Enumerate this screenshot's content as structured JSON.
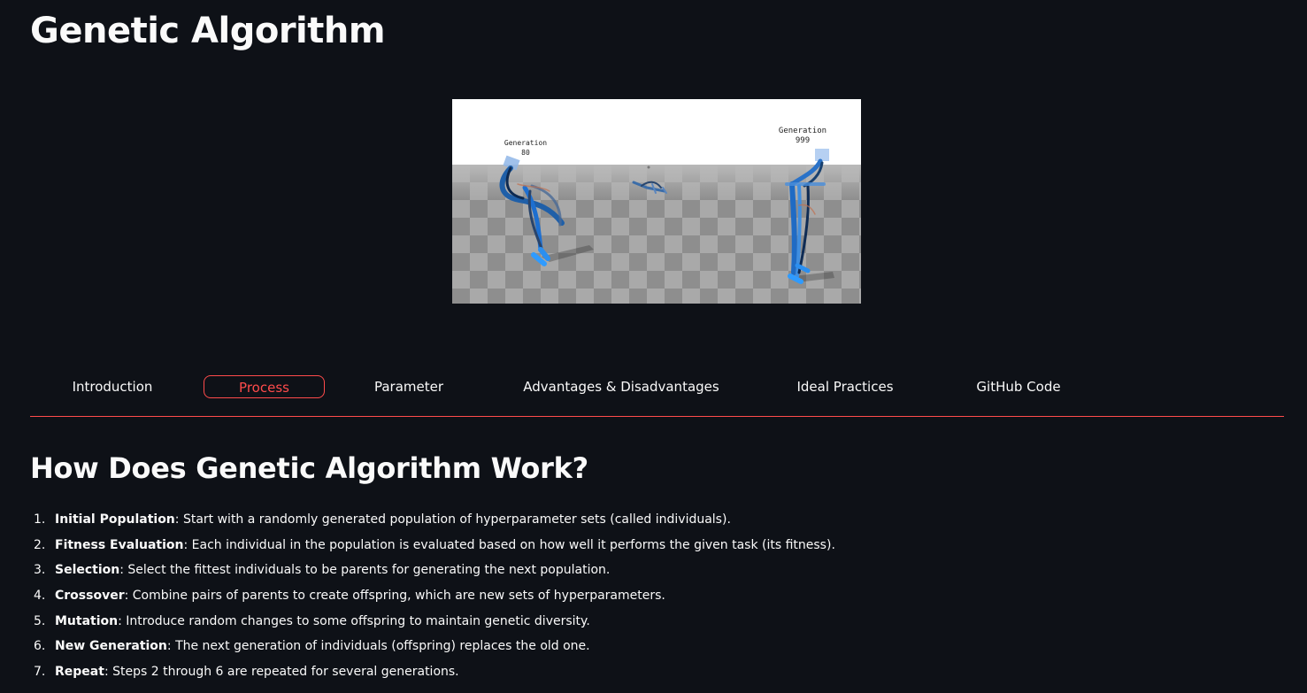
{
  "page": {
    "title": "Genetic Algorithm"
  },
  "hero": {
    "left_label_line1": "Generation",
    "left_label_line2": "80",
    "right_label_line1": "Generation",
    "right_label_line2": "999"
  },
  "tabs": [
    {
      "label": "Introduction",
      "active": false
    },
    {
      "label": "Process",
      "active": true
    },
    {
      "label": "Parameter",
      "active": false
    },
    {
      "label": "Advantages & Disadvantages",
      "active": false
    },
    {
      "label": "Ideal Practices",
      "active": false
    },
    {
      "label": "GitHub Code",
      "active": false
    }
  ],
  "section": {
    "title": "How Does Genetic Algorithm Work?"
  },
  "steps": [
    {
      "num": "1.",
      "term": "Initial Population",
      "text": ": Start with a randomly generated population of hyperparameter sets (called individuals)."
    },
    {
      "num": "2.",
      "term": "Fitness Evaluation",
      "text": ": Each individual in the population is evaluated based on how well it performs the given task (its fitness)."
    },
    {
      "num": "3.",
      "term": "Selection",
      "text": ": Select the fittest individuals to be parents for generating the next population."
    },
    {
      "num": "4.",
      "term": "Crossover",
      "text": ": Combine pairs of parents to create offspring, which are new sets of hyperparameters."
    },
    {
      "num": "5.",
      "term": "Mutation",
      "text": ": Introduce random changes to some offspring to maintain genetic diversity."
    },
    {
      "num": "6.",
      "term": "New Generation",
      "text": ": The next generation of individuals (offspring) replaces the old one."
    },
    {
      "num": "7.",
      "term": "Repeat",
      "text": ": Steps 2 through 6 are repeated for several generations."
    }
  ],
  "colors": {
    "background": "#0e1117",
    "text": "#fafafa",
    "accent": "#ff4b4b"
  }
}
